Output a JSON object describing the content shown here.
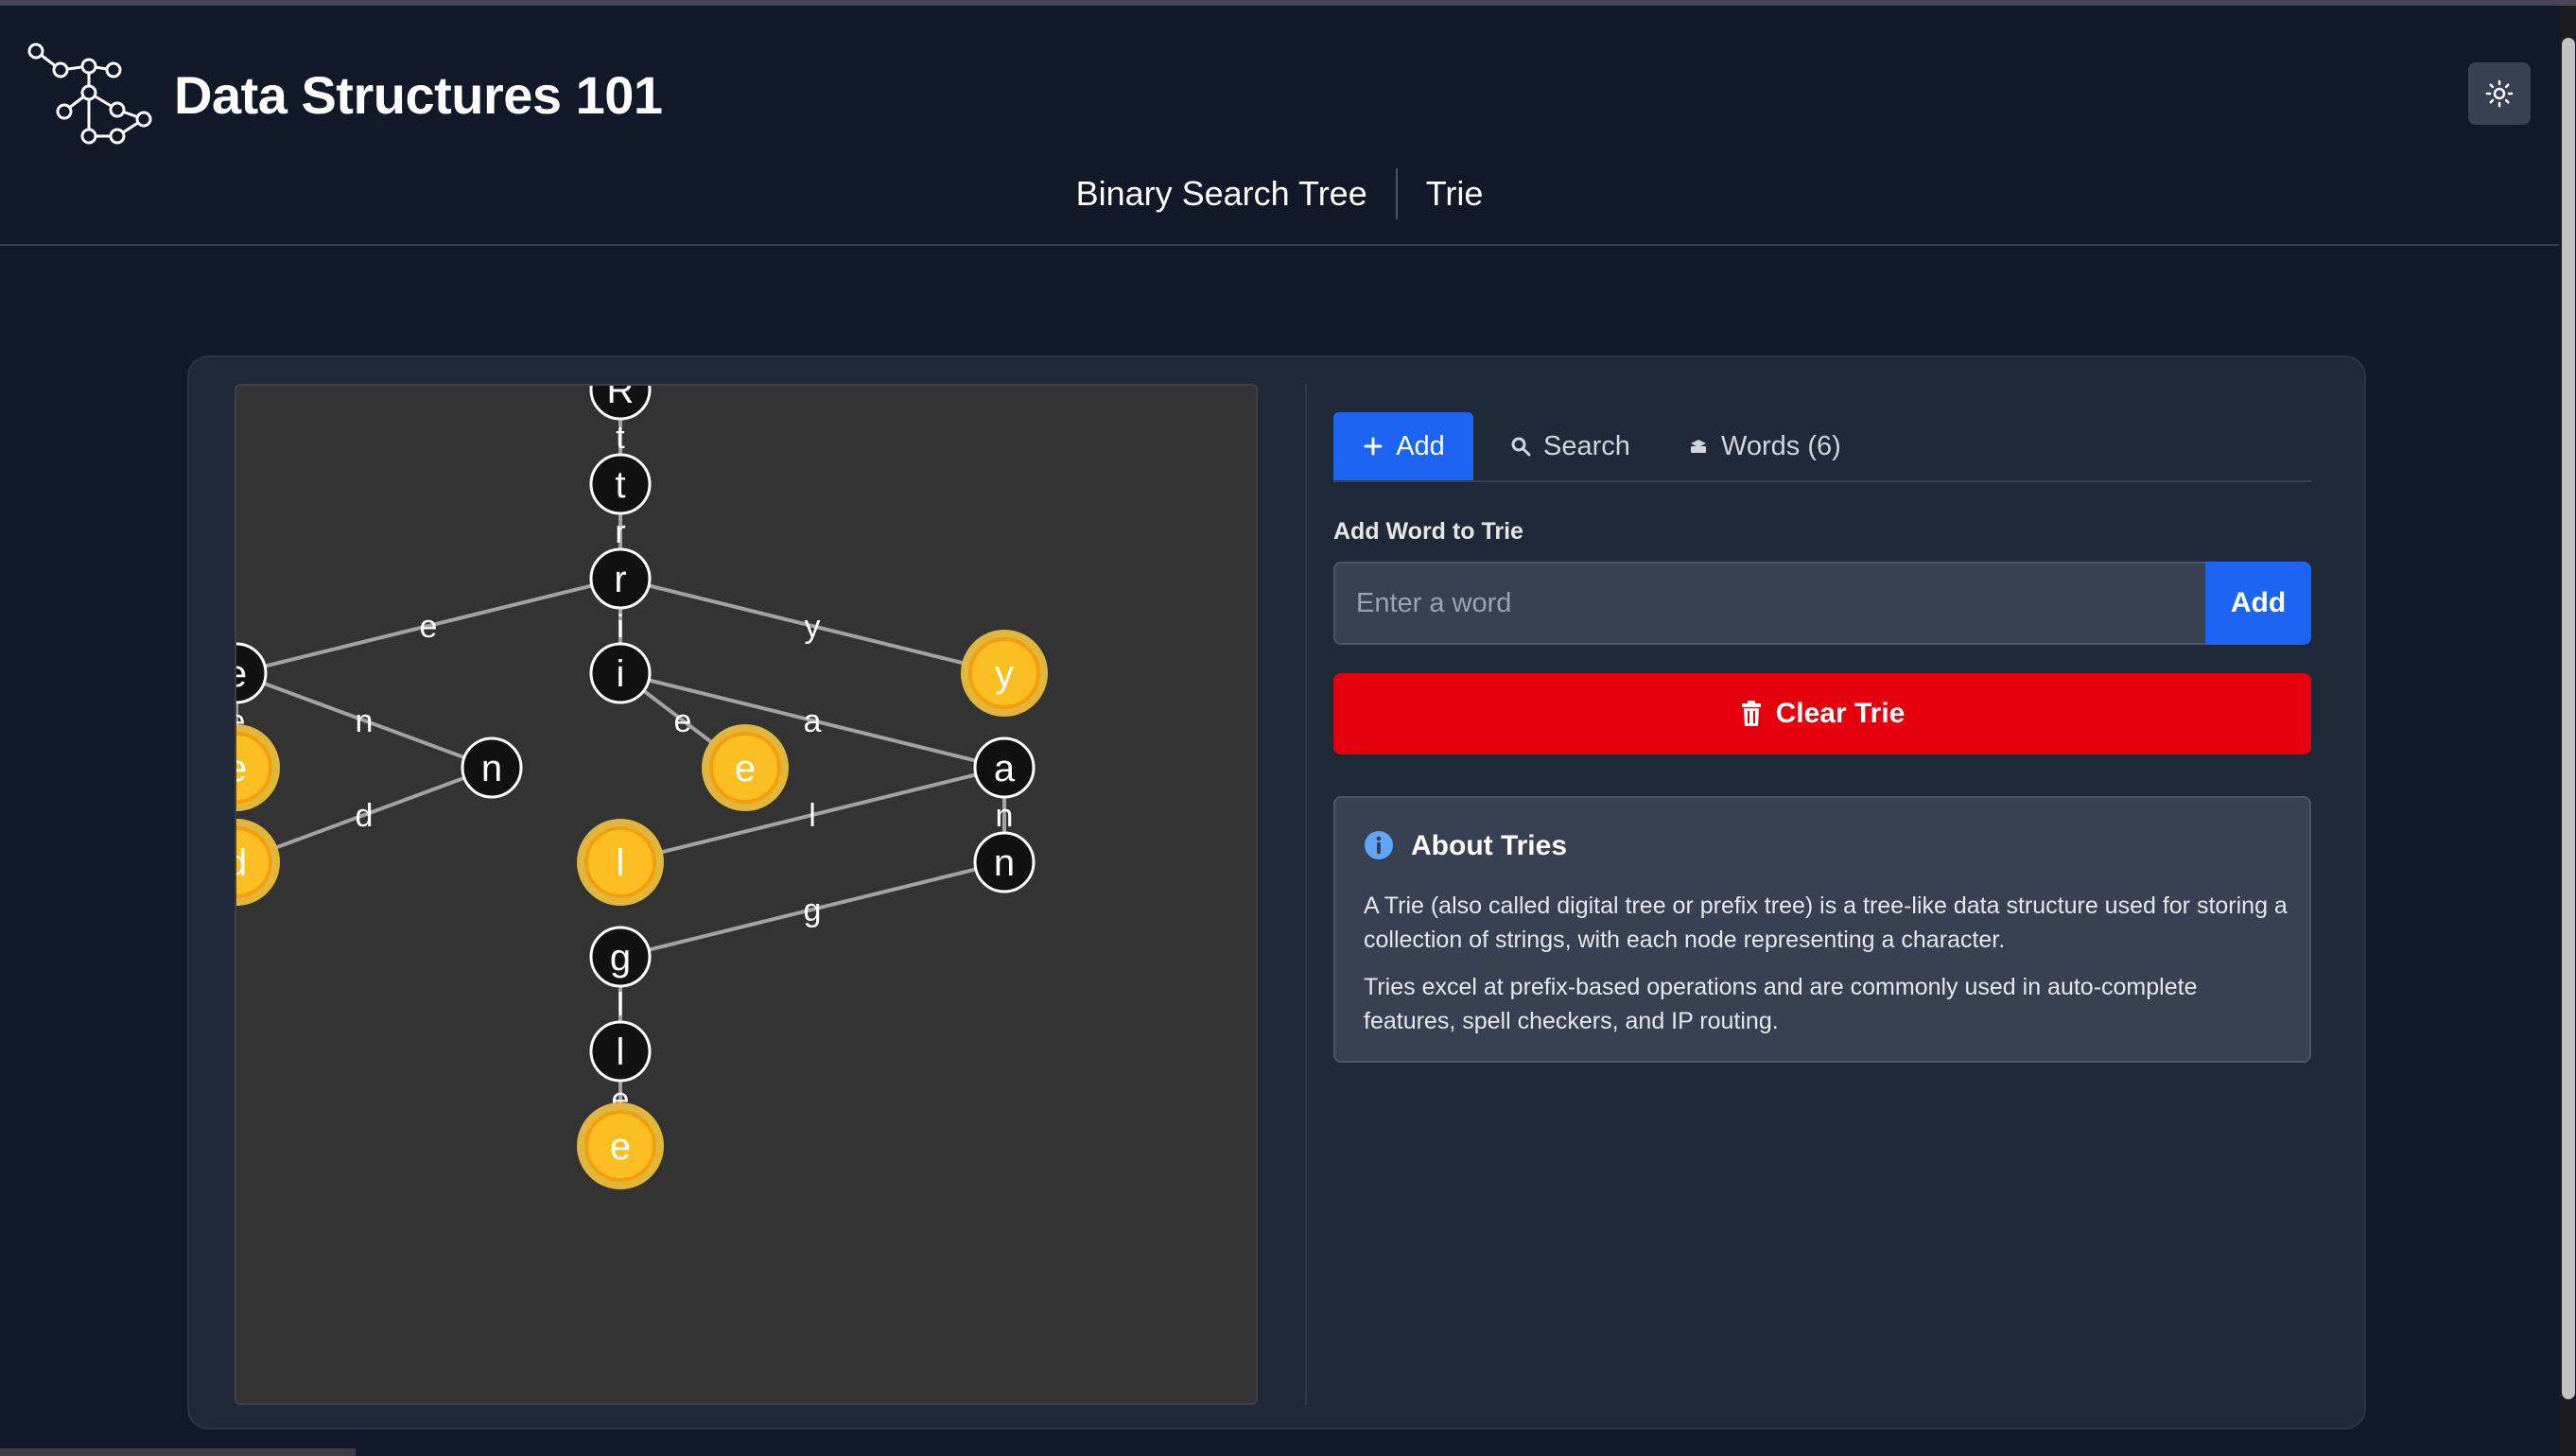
{
  "app": {
    "title": "Data Structures 101"
  },
  "nav": {
    "tabs": [
      "Binary Search Tree",
      "Trie"
    ]
  },
  "icons": {
    "logo": "tree-logo-icon",
    "theme_toggle": "sun-icon",
    "add_tab": "plus-icon",
    "search_tab": "search-icon",
    "words_tab": "stack-icon",
    "clear": "trash-icon",
    "about": "info-icon"
  },
  "panel": {
    "tabs": {
      "add": "Add",
      "search": "Search",
      "words": "Words (6)"
    },
    "form_label": "Add Word to Trie",
    "input_placeholder": "Enter a word",
    "input_value": "",
    "add_button": "Add",
    "clear_button": "Clear Trie",
    "about": {
      "title": "About Tries",
      "p1": "A Trie (also called digital tree or prefix tree) is a tree-like data structure used for storing a collection of strings, with each node representing a character.",
      "p2": "Tries excel at prefix-based operations and are commonly used in auto-complete features, spell checkers, and IP routing."
    }
  },
  "trie": {
    "nodes": [
      {
        "id": "R",
        "label": "R",
        "end": false
      },
      {
        "id": "t",
        "label": "t",
        "end": false
      },
      {
        "id": "r",
        "label": "r",
        "end": false
      },
      {
        "id": "e1",
        "label": "e",
        "end": false
      },
      {
        "id": "i",
        "label": "i",
        "end": false
      },
      {
        "id": "y",
        "label": "y",
        "end": true
      },
      {
        "id": "e2",
        "label": "e",
        "end": true
      },
      {
        "id": "n1",
        "label": "n",
        "end": false
      },
      {
        "id": "e3",
        "label": "e",
        "end": true
      },
      {
        "id": "a",
        "label": "a",
        "end": false
      },
      {
        "id": "d",
        "label": "d",
        "end": true
      },
      {
        "id": "l1",
        "label": "l",
        "end": true
      },
      {
        "id": "n2",
        "label": "n",
        "end": false
      },
      {
        "id": "g",
        "label": "g",
        "end": false
      },
      {
        "id": "l2",
        "label": "l",
        "end": false
      },
      {
        "id": "e4",
        "label": "e",
        "end": true
      }
    ],
    "edges": [
      {
        "from": "R",
        "to": "t",
        "label": "t"
      },
      {
        "from": "t",
        "to": "r",
        "label": "r"
      },
      {
        "from": "r",
        "to": "e1",
        "label": "e"
      },
      {
        "from": "r",
        "to": "i",
        "label": "i"
      },
      {
        "from": "r",
        "to": "y",
        "label": "y"
      },
      {
        "from": "e1",
        "to": "n1",
        "label": "n"
      },
      {
        "from": "e1",
        "to": "e3",
        "label": "e"
      },
      {
        "from": "n1",
        "to": "d",
        "label": "d"
      },
      {
        "from": "i",
        "to": "e2",
        "label": "e"
      },
      {
        "from": "i",
        "to": "a",
        "label": "a"
      },
      {
        "from": "a",
        "to": "l1",
        "label": "l"
      },
      {
        "from": "a",
        "to": "n2",
        "label": "n"
      },
      {
        "from": "n2",
        "to": "g",
        "label": "g"
      },
      {
        "from": "g",
        "to": "l2",
        "label": "l"
      },
      {
        "from": "l2",
        "to": "e4",
        "label": "e"
      }
    ]
  }
}
